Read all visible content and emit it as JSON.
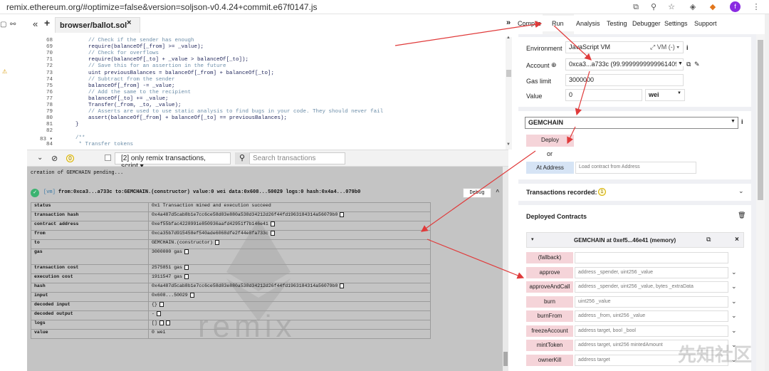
{
  "browser": {
    "url": "remix.ethereum.org/#optimize=false&version=soljson-v0.4.24+commit.e67f0147.js",
    "avatar_letter": "f"
  },
  "editor": {
    "tab_name": "browser/ballot.sol",
    "tab_close": "×",
    "left_icons": [
      "«",
      "+"
    ],
    "lines": [
      {
        "n": "68",
        "text": "        // Check if the sender has enough",
        "cmt": true
      },
      {
        "n": "69",
        "text": "        require(balanceOf[_from] >= _value);",
        "cmt": false
      },
      {
        "n": "70",
        "text": "        // Check for overflows",
        "cmt": true
      },
      {
        "n": "71",
        "text": "        require(balanceOf[_to] + _value > balanceOf[_to]);",
        "cmt": false
      },
      {
        "n": "72",
        "text": "        // Save this for an assertion in the future",
        "cmt": true
      },
      {
        "n": "73",
        "text": "        uint previousBalances = balanceOf[_from] + balanceOf[_to];",
        "cmt": false
      },
      {
        "n": "74",
        "text": "        // Subtract from the sender",
        "cmt": true
      },
      {
        "n": "75",
        "text": "        balanceOf[_from] -= _value;",
        "cmt": false
      },
      {
        "n": "76",
        "text": "        // Add the same to the recipient",
        "cmt": true
      },
      {
        "n": "77",
        "text": "        balanceOf[_to] += _value;",
        "cmt": false
      },
      {
        "n": "78",
        "text": "        Transfer(_from, _to, _value);",
        "cmt": false
      },
      {
        "n": "79",
        "text": "        // Asserts are used to use static analysis to find bugs in your code. They should never fail",
        "cmt": true
      },
      {
        "n": "80",
        "text": "        assert(balanceOf[_from] + balanceOf[_to] == previousBalances);",
        "cmt": false
      },
      {
        "n": "81",
        "text": "    }",
        "cmt": false
      },
      {
        "n": "82",
        "text": "",
        "cmt": false
      },
      {
        "n": "83 ▾",
        "text": "    /**",
        "cmt": true
      },
      {
        "n": "84",
        "text": "     * Transfer tokens",
        "cmt": true
      }
    ]
  },
  "terminal_bar": {
    "count": "0",
    "filter": "[2] only remix transactions, script ▾",
    "search_placeholder": "Search transactions"
  },
  "terminal": {
    "pending": "creation of GEMCHAIN pending...",
    "vm": "[vm]",
    "tx_summary": "from:0xca3...a733c to:GEMCHAIN.(constructor) value:0 wei data:0x608...50029 logs:0 hash:0x4a4...079b0",
    "debug": "Debug",
    "watermark": "remix",
    "rows": [
      {
        "k": "status",
        "v": "0x1 Transaction mined and execution succeed",
        "copy": 0
      },
      {
        "k": "transaction hash",
        "v": "0x4a487d5cab8b1e7cc6ce58d83e880a538d34212d26f44fd1963184314a56079b0",
        "copy": 1
      },
      {
        "k": "contract address",
        "v": "0xef55bfac4228991e850936aafd42951f7b146e41",
        "copy": 1
      },
      {
        "k": "from",
        "v": "0xca35b7d915458ef540ade6068dfe2f44e8fa733c",
        "copy": 1
      },
      {
        "k": "to",
        "v": "GEMCHAIN.(constructor)",
        "copy": 1
      },
      {
        "k": "gas",
        "v": "3000000 gas",
        "copy": 1
      },
      {
        "k": "transaction cost",
        "v": "2575851 gas",
        "copy": 1
      },
      {
        "k": "execution cost",
        "v": "1911547 gas",
        "copy": 1
      },
      {
        "k": "hash",
        "v": "0x4a487d5cab8b1e7cc6ce58d83e880a538d34212d26f44fd1963184314a56079b0",
        "copy": 1
      },
      {
        "k": "input",
        "v": "0x608...50029",
        "copy": 1
      },
      {
        "k": "decoded input",
        "v": "{}",
        "copy": 1
      },
      {
        "k": "decoded output",
        "v": "-",
        "copy": 1
      },
      {
        "k": "logs",
        "v": "[]",
        "copy": 2
      },
      {
        "k": "value",
        "v": "0 wei",
        "copy": 0
      }
    ]
  },
  "nav": {
    "tabs": [
      "Compile",
      "Run",
      "Analysis",
      "Testing",
      "Debugger",
      "Settings",
      "Support"
    ],
    "active": "Run",
    "arrow": "»"
  },
  "run": {
    "environment_label": "Environment",
    "environment_value": "JavaScript VM",
    "environment_vm": "VM (-)",
    "account_label": "Account",
    "account_value": "0xca3...a733c (99.9999999999961409",
    "gaslimit_label": "Gas limit",
    "gaslimit_value": "3000000",
    "value_label": "Value",
    "value_value": "0",
    "value_unit": "wei",
    "contract_select": "GEMCHAIN",
    "deploy": "Deploy",
    "or": "or",
    "at_address": "At Address",
    "at_address_placeholder": "Load contract from Address",
    "tx_recorded": "Transactions recorded:",
    "tx_recorded_count": "1",
    "deployed_title": "Deployed Contracts",
    "instance_title": "GEMCHAIN at 0xef5...46e41 (memory)",
    "functions": [
      {
        "name": "(fallback)",
        "params": ""
      },
      {
        "name": "approve",
        "params": "address _spender, uint256 _value"
      },
      {
        "name": "approveAndCall",
        "params": "address _spender, uint256 _value, bytes _extraData"
      },
      {
        "name": "burn",
        "params": "uint256 _value"
      },
      {
        "name": "burnFrom",
        "params": "address _from, uint256 _value"
      },
      {
        "name": "freezeAccount",
        "params": "address target, bool _bool"
      },
      {
        "name": "mintToken",
        "params": "address target, uint256 mintedAmount"
      },
      {
        "name": "ownerKill",
        "params": "address target"
      }
    ]
  },
  "overlay_watermark": "先知社区",
  "colors": {
    "annotation_arrow": "#e03a3a",
    "deploy_button": "#f5d4d9",
    "at_address_button": "#d6e4f5",
    "panel_bg": "#eff0f4",
    "terminal_bg": "#c4c4c4"
  }
}
